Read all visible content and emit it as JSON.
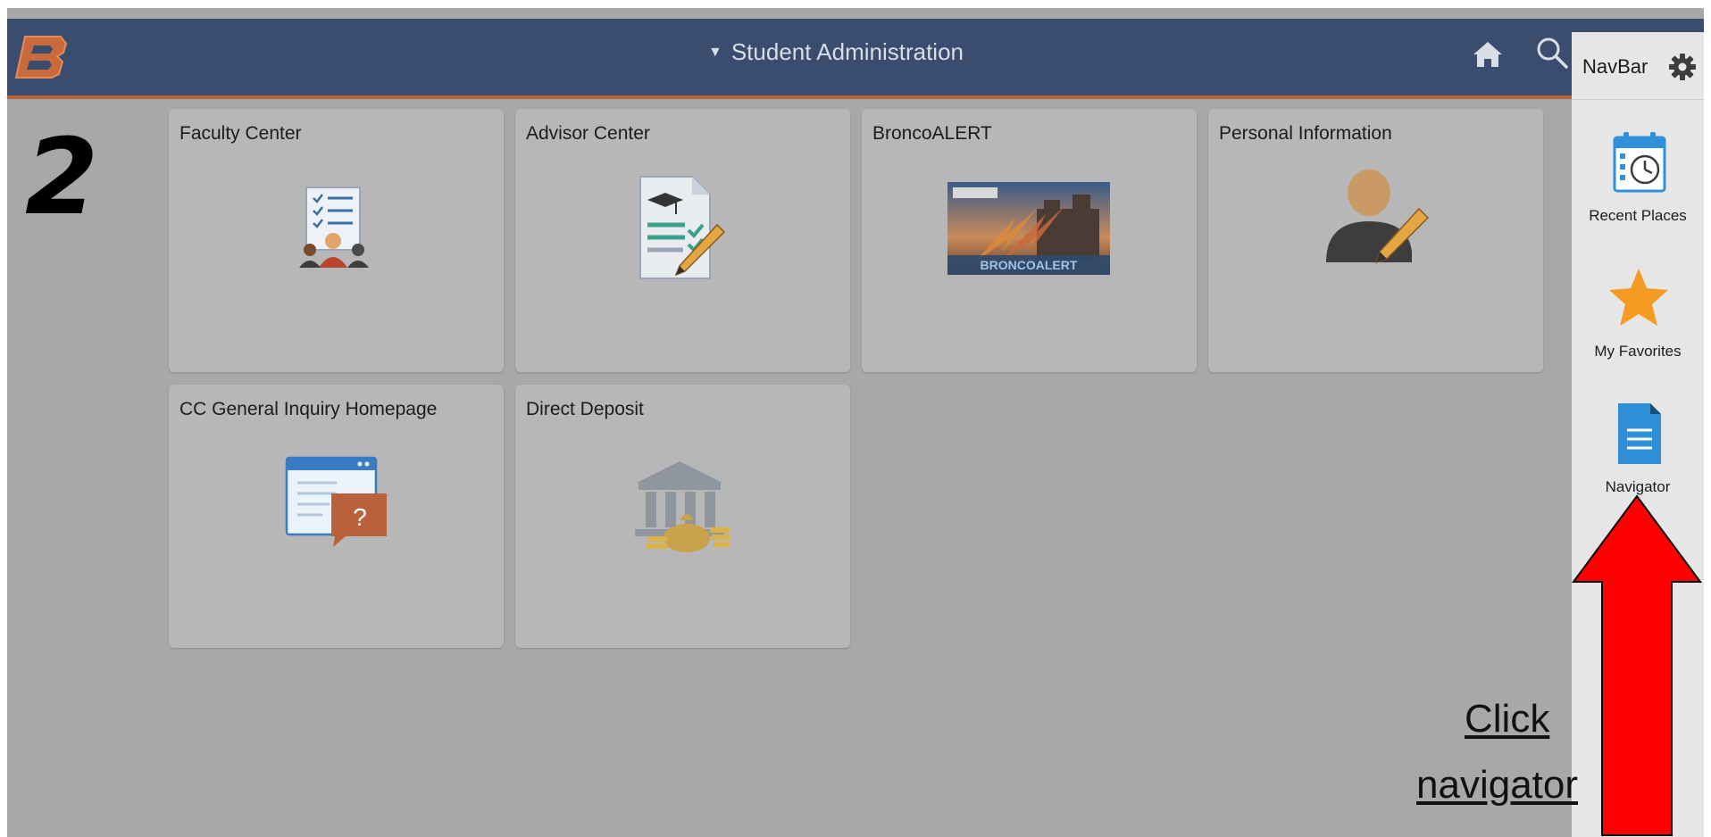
{
  "header": {
    "title": "Student Administration"
  },
  "step_number": "2",
  "tiles": [
    {
      "label": "Faculty Center",
      "icon": "faculty-center-icon"
    },
    {
      "label": "Advisor Center",
      "icon": "advisor-center-icon"
    },
    {
      "label": "BroncoALERT",
      "icon": "broncoalert-image",
      "banner_text": "BRONCOALERT"
    },
    {
      "label": "Personal Information",
      "icon": "personal-information-icon"
    },
    {
      "label": "CC General Inquiry Homepage",
      "icon": "general-inquiry-icon"
    },
    {
      "label": "Direct Deposit",
      "icon": "direct-deposit-icon"
    }
  ],
  "navbar": {
    "label": "NavBar",
    "items": [
      {
        "label": "Recent Places",
        "icon": "calendar-clock-icon"
      },
      {
        "label": "My Favorites",
        "icon": "star-icon"
      },
      {
        "label": "Navigator",
        "icon": "document-icon"
      }
    ]
  },
  "annotation": {
    "line1": "Click",
    "line2": "navigator"
  },
  "colors": {
    "header_bg": "#3a4d6e",
    "header_accent": "#b8613b",
    "overlay_bg": "#a8a8a8",
    "tile_bg": "#b7b7b7",
    "navbar_bg": "#e6e6e6",
    "arrow_red": "#ff0000",
    "star_orange": "#f59a23",
    "navigator_blue": "#2f8fd8"
  }
}
